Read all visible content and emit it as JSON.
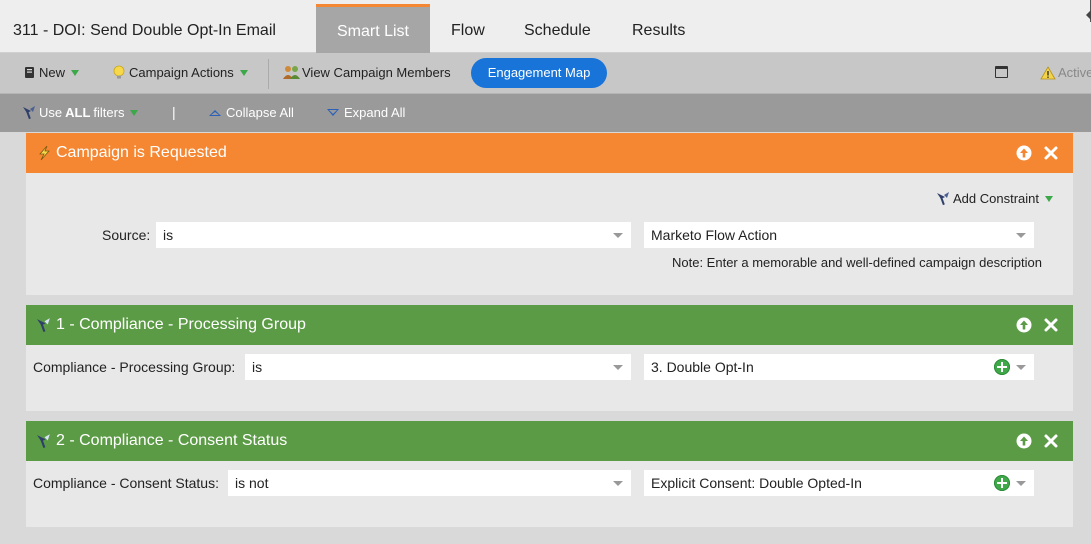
{
  "window": {
    "title": "311 - DOI: Send Double Opt-In Email",
    "tabs": [
      {
        "label": "Smart List",
        "active": true
      },
      {
        "label": "Flow",
        "active": false
      },
      {
        "label": "Schedule",
        "active": false
      },
      {
        "label": "Results",
        "active": false
      }
    ]
  },
  "toolbar": {
    "new_label": "New",
    "campaign_actions_label": "Campaign Actions",
    "view_members_label": "View Campaign Members",
    "engagement_map_label": "Engagement Map",
    "active_label": "Active"
  },
  "filterbar": {
    "use_label": "Use",
    "all_label": "ALL",
    "filters_label": "filters",
    "separator": "|",
    "collapse_all_label": "Collapse All",
    "expand_all_label": "Expand All"
  },
  "trigger": {
    "title": "Campaign is Requested",
    "add_constraint_label": "Add Constraint",
    "source_label": "Source:",
    "operator": "is",
    "value": "Marketo Flow Action",
    "note": "Note: Enter a memorable and well-defined campaign description"
  },
  "filters": [
    {
      "title": "1 - Compliance - Processing Group",
      "field_label": "Compliance - Processing Group:",
      "operator": "is",
      "value": "3. Double Opt-In"
    },
    {
      "title": "2 - Compliance - Consent Status",
      "field_label": "Compliance - Consent Status:",
      "operator": "is not",
      "value": "Explicit Consent: Double Opted-In"
    }
  ],
  "colors": {
    "trigger_header": "#f58732",
    "filter_header": "#5c9b46",
    "engagement_button": "#1874d9",
    "active_tab_accent": "#f58732"
  },
  "icons": {
    "new": "document-icon",
    "campaign_actions": "lightbulb-icon",
    "view_members": "people-icon",
    "use_filters": "funnel-icon",
    "trigger": "lightning-bolt-icon",
    "filter": "funnel-icon",
    "move_up": "arrow-up-circle-icon",
    "remove": "close-icon",
    "add_value": "plus-circle-icon"
  }
}
